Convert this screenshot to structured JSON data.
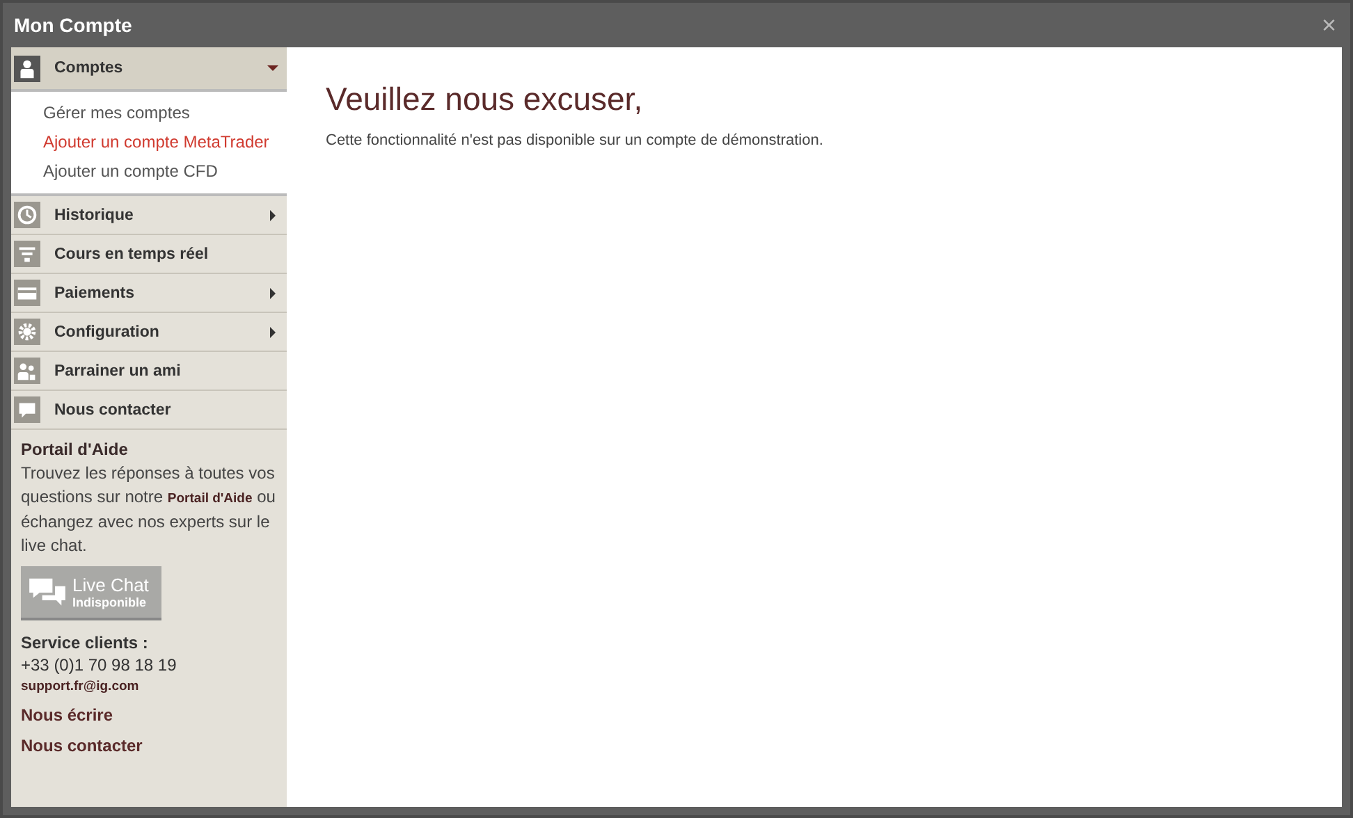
{
  "window": {
    "title": "Mon Compte",
    "close": "×"
  },
  "nav": [
    {
      "label": "Comptes",
      "expanded": true,
      "children": [
        {
          "label": "Gérer mes comptes",
          "selected": false
        },
        {
          "label": "Ajouter un compte MetaTrader",
          "selected": true
        },
        {
          "label": "Ajouter un compte CFD",
          "selected": false
        }
      ]
    },
    {
      "label": "Historique",
      "expanded": false
    },
    {
      "label": "Cours en temps réel"
    },
    {
      "label": "Paiements",
      "expanded": false
    },
    {
      "label": "Configuration",
      "expanded": false
    },
    {
      "label": "Parrainer un ami"
    },
    {
      "label": "Nous contacter"
    }
  ],
  "help": {
    "title": "Portail d'Aide",
    "text": "Trouvez les réponses à toutes vos questions sur notre",
    "link": "Portail d'Aide",
    "text_after": "ou échangez avec nos experts sur le live chat.",
    "chat_button": {
      "label": "Live Chat",
      "status": "Indisponible",
      "disabled": true
    },
    "service_title": "Service clients :",
    "phone": "+33 (0)1 70 98 18 19",
    "email": "support.fr@ig.com",
    "links": [
      "Nous écrire",
      "Nous contacter"
    ]
  },
  "content": {
    "heading": "Veuillez nous excuser,",
    "message": "Cette fonctionnalité n'est pas disponible sur un compte de démonstration."
  }
}
